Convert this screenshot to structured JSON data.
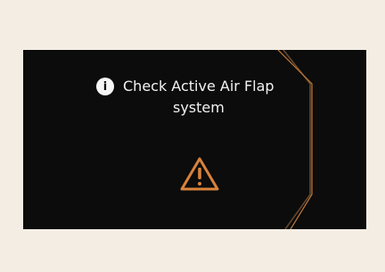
{
  "warning": {
    "icon": "info-icon",
    "line1": "Check Active Air Flap",
    "line2": "system",
    "alert_icon": "warning-triangle-icon"
  },
  "colors": {
    "background": "#f3ede4",
    "display": "#0c0c0c",
    "accent": "#d9823b",
    "text": "#f2f2f2"
  }
}
